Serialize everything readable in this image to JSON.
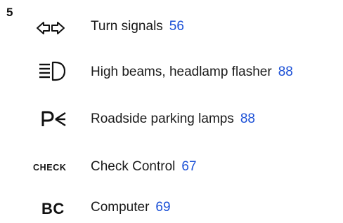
{
  "section_number": "5",
  "items": [
    {
      "icon": "turn-signal-arrows-icon",
      "label": "Turn signals",
      "page": "56"
    },
    {
      "icon": "high-beam-icon",
      "label": "High beams, headlamp flasher",
      "page": "88"
    },
    {
      "icon": "parking-lamp-icon",
      "label": "Roadside parking lamps",
      "page": "88"
    },
    {
      "icon": "check-control-icon",
      "icon_text": "CHECK",
      "label": "Check Control",
      "page": "67"
    },
    {
      "icon": "computer-icon",
      "icon_text": "BC",
      "label": "Computer",
      "page": "69"
    }
  ],
  "colors": {
    "text": "#1a1a1a",
    "link": "#1a4fd6"
  }
}
